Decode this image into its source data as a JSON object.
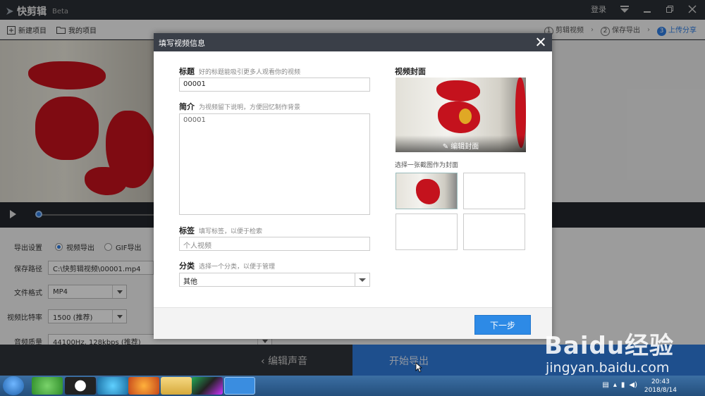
{
  "app": {
    "name": "快剪辑",
    "edition": "Beta",
    "login": "登录"
  },
  "toolbar": {
    "new_project": "新建项目",
    "my_projects": "我的项目",
    "steps": [
      {
        "num": "1",
        "label": "剪辑视频"
      },
      {
        "num": "2",
        "label": "保存导出"
      },
      {
        "num": "3",
        "label": "上传分享"
      }
    ]
  },
  "export_settings": {
    "label": "导出设置",
    "opt_video": "视频导出",
    "opt_gif": "GIF导出",
    "path_label": "保存路径",
    "path_value": "C:\\快剪辑视频\\00001.mp4",
    "format_label": "文件格式",
    "format_value": "MP4",
    "bitrate_label": "视频比特率",
    "bitrate_value": "1500 (推荐)",
    "audio_label": "音频质量",
    "audio_value": "44100Hz, 128kbps (推荐)"
  },
  "bottom": {
    "edit_audio": "编辑声音",
    "start_export": "开始导出"
  },
  "dialog": {
    "title": "填写视频信息",
    "title_label": "标题",
    "title_hint": "好的标题能吸引更多人观看你的视频",
    "title_value": "00001",
    "intro_label": "简介",
    "intro_hint": "为视频留下说明，方便回忆制作背景",
    "intro_value": "00001",
    "tags_label": "标签",
    "tags_hint": "填写标签，以便于检索",
    "tags_placeholder": "个人视频",
    "category_label": "分类",
    "category_hint": "选择一个分类，以便于管理",
    "category_value": "其他",
    "cover_label": "视频封面",
    "edit_cover": "编辑封面",
    "choose_cover": "选择一张截图作为封面",
    "next_button": "下一步"
  },
  "taskbar": {
    "time": "20:43",
    "date": "2018/8/14"
  },
  "watermark": {
    "brand": "Baidu经验",
    "url": "jingyan.baidu.com"
  },
  "colors": {
    "accent": "#2d7be0",
    "dialog_header": "#3a3f48",
    "next_button": "#2d8ae6"
  }
}
